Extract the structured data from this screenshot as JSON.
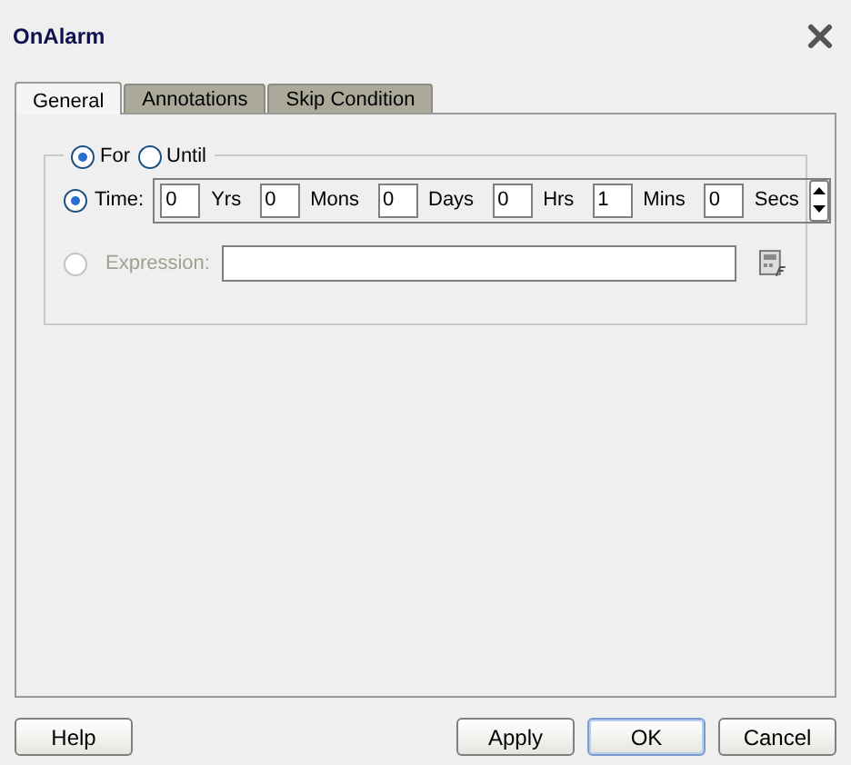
{
  "window": {
    "title": "OnAlarm"
  },
  "tabs": [
    {
      "label": "General",
      "selected": true
    },
    {
      "label": "Annotations",
      "selected": false
    },
    {
      "label": "Skip Condition",
      "selected": false
    }
  ],
  "mode": [
    {
      "label": "For",
      "selected": true
    },
    {
      "label": "Until",
      "selected": false
    }
  ],
  "time": {
    "label": "Time:",
    "selected": true,
    "units": [
      {
        "value": "0",
        "unit": "Yrs"
      },
      {
        "value": "0",
        "unit": "Mons"
      },
      {
        "value": "0",
        "unit": "Days"
      },
      {
        "value": "0",
        "unit": "Hrs"
      },
      {
        "value": "1",
        "unit": "Mins"
      },
      {
        "value": "0",
        "unit": "Secs"
      }
    ]
  },
  "expression": {
    "label": "Expression:",
    "selected": false,
    "disabled": true
  },
  "buttons": [
    {
      "label": "Help",
      "default": false
    },
    {
      "label": "Apply",
      "default": false
    },
    {
      "label": "OK",
      "default": true
    },
    {
      "label": "Cancel",
      "default": false
    }
  ]
}
